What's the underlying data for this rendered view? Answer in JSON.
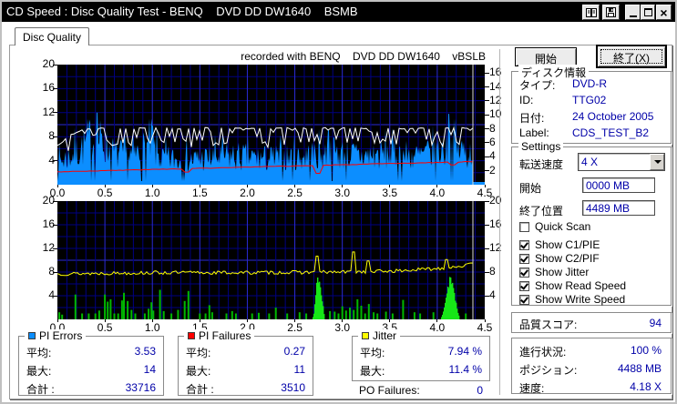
{
  "window": {
    "title": "CD Speed : Disc Quality Test - BENQ    DVD DD DW1640    BSMB"
  },
  "icons": {
    "book": "open-book",
    "save": "floppy-disk",
    "minimize": "_",
    "maximize": "□",
    "close": "×"
  },
  "tab": {
    "label": "Disc Quality"
  },
  "chart_header": "recorded with BENQ    DVD DD DW1640    vBSLB",
  "actions": {
    "start": "開始",
    "exit": "終了(X)"
  },
  "disc_info": {
    "title": "ディスク情報",
    "rows": [
      {
        "label": "タイプ:",
        "value": "DVD-R"
      },
      {
        "label": "ID:",
        "value": "TTG02"
      },
      {
        "label": "日付:",
        "value": "24 October 2005"
      },
      {
        "label": "Label:",
        "value": "CDS_TEST_B2"
      }
    ]
  },
  "settings": {
    "title": "Settings",
    "speed": {
      "label": "転送速度",
      "value": "4 X"
    },
    "start": {
      "label": "開始",
      "value": "0000 MB"
    },
    "end": {
      "label": "終了位置",
      "value": "4489 MB"
    },
    "checkboxes": [
      {
        "label": "Quick Scan",
        "checked": false
      },
      {
        "label": "Show C1/PIE",
        "checked": true
      },
      {
        "label": "Show C2/PIF",
        "checked": true
      },
      {
        "label": "Show Jitter",
        "checked": true
      },
      {
        "label": "Show Read Speed",
        "checked": true
      },
      {
        "label": "Show Write Speed",
        "checked": true
      }
    ]
  },
  "score": {
    "label": "品質スコア:",
    "value": "94"
  },
  "progress": {
    "rows": [
      {
        "label": "進行状況:",
        "value": "100 %"
      },
      {
        "label": "ポジション:",
        "value": "4488 MB"
      },
      {
        "label": "速度:",
        "value": "4.18 X"
      }
    ]
  },
  "stats": {
    "boxes": [
      {
        "title": "PI Errors",
        "color": "#0c8eff",
        "rows": [
          {
            "label": "平均:",
            "value": "3.53"
          },
          {
            "label": "最大:",
            "value": "14"
          },
          {
            "label": "合計 :",
            "value": "33716"
          }
        ]
      },
      {
        "title": "PI Failures",
        "color": "#ff0000",
        "rows": [
          {
            "label": "平均:",
            "value": "0.27"
          },
          {
            "label": "最大:",
            "value": "11"
          },
          {
            "label": "合計 :",
            "value": "3510"
          }
        ]
      },
      {
        "title": "Jitter",
        "color": "#ffff00",
        "rows": [
          {
            "label": "平均:",
            "value": "7.94 %"
          },
          {
            "label": "最大:",
            "value": "11.4 %"
          }
        ]
      }
    ],
    "po_failures": {
      "label": "PO Failures:",
      "value": "0"
    }
  },
  "chart_data": [
    {
      "id": "chart1",
      "type": "area",
      "title": "PI Errors / Read & Write speed vs position (GB)",
      "x_range": [
        0,
        4.5
      ],
      "y_range": [
        0,
        20
      ],
      "right_axis_range": [
        0,
        17.2
      ],
      "x_ticks": [
        "0.0",
        "0.5",
        "1.0",
        "1.5",
        "2.0",
        "2.5",
        "3.0",
        "3.5",
        "4.0",
        "4.5"
      ],
      "left_ticks": [
        20,
        16,
        12,
        8,
        4
      ],
      "right_ticks": [
        16,
        14,
        12,
        10,
        8,
        6,
        4,
        2
      ],
      "grid": {
        "minor_x": 0.1,
        "major_x": 0.5,
        "minor_y": 2,
        "major_y": 10,
        "minor_color": "#000082",
        "major_color": "#2a2ad4"
      },
      "cursor_x": 4.38,
      "cursor_color": "#d9d9d9",
      "series": [
        {
          "name": "PI Errors",
          "kind": "noise-area",
          "color": "#0c8eff",
          "seed": 7,
          "envelope": [
            [
              0,
              3.5
            ],
            [
              0.2,
              5.2
            ],
            [
              0.35,
              7.4
            ],
            [
              0.45,
              7.0
            ],
            [
              0.6,
              5.0
            ],
            [
              0.8,
              4.6
            ],
            [
              0.97,
              6.4
            ],
            [
              1.1,
              4.2
            ],
            [
              1.4,
              4.0
            ],
            [
              1.8,
              4.6
            ],
            [
              2.2,
              4.2
            ],
            [
              2.6,
              4.6
            ],
            [
              2.9,
              5.2
            ],
            [
              3.2,
              4.6
            ],
            [
              3.5,
              5.0
            ],
            [
              3.8,
              4.6
            ],
            [
              4.05,
              5.6
            ],
            [
              4.15,
              6.0
            ],
            [
              4.38,
              5.0
            ]
          ],
          "noise": 0.85,
          "dropout": 0.06,
          "spike_chance": 0.035,
          "peaks": [
            [
              0.42,
              12.0
            ],
            [
              1.0,
              9.8
            ],
            [
              2.85,
              9.2
            ],
            [
              4.12,
              11.8
            ]
          ],
          "stats": {
            "avg": 3.53,
            "max": 14,
            "total": 33716
          }
        },
        {
          "name": "Write Speed",
          "kind": "noise-line",
          "color": "#ff0000",
          "seed": 3,
          "envelope": [
            [
              0,
              2.15
            ],
            [
              4.38,
              3.85
            ]
          ],
          "noise": 0.05,
          "step": 4,
          "peaks": [
            [
              1.35,
              2.1
            ],
            [
              2.75,
              1.9
            ],
            [
              4.15,
              3.3
            ]
          ]
        },
        {
          "name": "Read Speed",
          "kind": "noise-line",
          "color": "#ffffff",
          "seed": 5,
          "envelope": [
            [
              0,
              6.5
            ],
            [
              0.15,
              8.4
            ],
            [
              0.3,
              9.4
            ],
            [
              4.38,
              9.4
            ]
          ],
          "noise": 0.12,
          "step": 3,
          "dips": {
            "chance": 0.42,
            "depth": 3.1
          }
        }
      ]
    },
    {
      "id": "chart2",
      "type": "bar+line",
      "title": "PI Failures / Jitter vs position (GB)",
      "x_range": [
        0,
        4.5
      ],
      "y_range": [
        0,
        20
      ],
      "right_axis_range": [
        0,
        20
      ],
      "x_ticks": [
        "0.0",
        "0.5",
        "1.0",
        "1.5",
        "2.0",
        "2.5",
        "3.0",
        "3.5",
        "4.0",
        "4.5"
      ],
      "left_ticks": [
        20,
        16,
        12,
        8,
        4
      ],
      "right_ticks": [
        20,
        16,
        12,
        8,
        4
      ],
      "grid": {
        "minor_x": 0.1,
        "major_x": 0.5,
        "minor_y": 2,
        "major_y": 10,
        "minor_color": "#000082",
        "major_color": "#2a2ad4"
      },
      "cursor_x": 4.38,
      "cursor_color": "#d9d9d9",
      "series": [
        {
          "name": "PI Failures",
          "kind": "bars",
          "color": "#00b800",
          "cluster_color": "#17e617",
          "seed": 11,
          "bars": [
            [
              0.02,
              1.2
            ],
            [
              0.05,
              0.8
            ],
            [
              0.19,
              4.2
            ],
            [
              0.26,
              1.0
            ],
            [
              0.33,
              1.0
            ],
            [
              0.4,
              1.0
            ],
            [
              0.44,
              1.5
            ],
            [
              0.5,
              4.2
            ],
            [
              0.53,
              3.0
            ],
            [
              0.56,
              3.4
            ],
            [
              0.6,
              1.0
            ],
            [
              0.64,
              1.0
            ],
            [
              0.68,
              3.2
            ],
            [
              0.7,
              4.5
            ],
            [
              0.74,
              3.1
            ],
            [
              0.78,
              1.6
            ],
            [
              0.82,
              1.0
            ],
            [
              0.92,
              1.0
            ],
            [
              0.96,
              1.8
            ],
            [
              0.99,
              2.9
            ],
            [
              1.01,
              1.5
            ],
            [
              1.08,
              5.0
            ],
            [
              1.12,
              1.4
            ],
            [
              1.2,
              1.0
            ],
            [
              1.27,
              1.6
            ],
            [
              1.34,
              3.1
            ],
            [
              1.38,
              4.8
            ],
            [
              1.5,
              1.0
            ],
            [
              1.56,
              1.0
            ],
            [
              1.6,
              2.4
            ],
            [
              1.63,
              1.2
            ],
            [
              1.78,
              1.0
            ],
            [
              1.84,
              1.4
            ],
            [
              1.88,
              1.0
            ],
            [
              2.05,
              1.0
            ],
            [
              2.12,
              1.1
            ],
            [
              2.23,
              1.0
            ],
            [
              2.3,
              2.0
            ],
            [
              2.42,
              1.0
            ],
            [
              2.55,
              1.2
            ],
            [
              2.62,
              1.0
            ],
            [
              2.87,
              1.4
            ],
            [
              2.92,
              1.3
            ],
            [
              2.96,
              1.0
            ],
            [
              3.0,
              2.2
            ],
            [
              3.04,
              1.5
            ],
            [
              3.08,
              2.0
            ],
            [
              3.12,
              1.6
            ],
            [
              3.16,
              3.4
            ],
            [
              3.2,
              2.3
            ],
            [
              3.24,
              1.0
            ],
            [
              3.28,
              2.6
            ],
            [
              3.33,
              1.2
            ],
            [
              3.37,
              1.0
            ],
            [
              3.46,
              1.3
            ],
            [
              3.53,
              1.0
            ],
            [
              3.64,
              3.3
            ],
            [
              3.76,
              1.2
            ],
            [
              3.82,
              1.0
            ],
            [
              3.96,
              1.2
            ],
            [
              4.3,
              1.0
            ]
          ],
          "clusters": [
            {
              "x0": 2.69,
              "x1": 2.81,
              "apex": 2.74,
              "peak": 8.2
            },
            {
              "x0": 4.04,
              "x1": 4.23,
              "apex": 4.13,
              "peak": 7.6
            }
          ],
          "stats": {
            "avg": 0.27,
            "max": 11,
            "total": 3510
          }
        },
        {
          "name": "Jitter",
          "kind": "noise-line",
          "color": "#ffff00",
          "seed": 13,
          "envelope": [
            [
              0,
              7.7
            ],
            [
              1.0,
              7.9
            ],
            [
              2.0,
              7.9
            ],
            [
              3.0,
              8.0
            ],
            [
              3.6,
              8.2
            ],
            [
              4.0,
              8.6
            ],
            [
              4.38,
              9.3
            ]
          ],
          "noise": 0.3,
          "step": 2,
          "peaks": [
            [
              2.74,
              10.7
            ],
            [
              3.12,
              11.4
            ],
            [
              3.27,
              9.9
            ],
            [
              4.1,
              10.1
            ]
          ],
          "stats": {
            "avg_pct": 7.94,
            "max_pct": 11.4
          }
        }
      ]
    }
  ]
}
